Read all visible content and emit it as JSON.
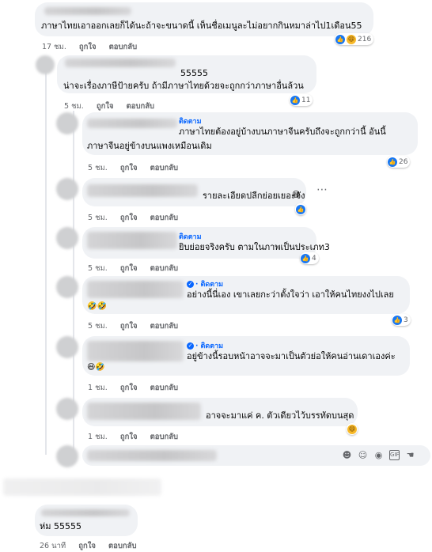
{
  "comments": [
    {
      "text_lines": [
        "ภาษาไทยเอาออกเลยก็ได้นะถ้าจะขนาดนี้ เห็นชื่อเมนูละไม่อยากกินหมาล่าไป1เดือน55"
      ],
      "reactions": "216",
      "time": "17 ชม.",
      "like": "ถูกใจ",
      "reply": "ตอบกลับ"
    },
    {
      "text_lines": [
        "55555",
        "น่าจะเรื่องภาษีป้ายครับ ถ้ามีภาษาไทยด้วยจะถูกกว่าภาษาอื่นล้วน"
      ],
      "reactions": "11",
      "time": "5 ชม.",
      "like": "ถูกใจ",
      "reply": "ตอบกลับ"
    },
    {
      "follow": "ติดตาม",
      "text_lines": [
        "ภาษาไทยต้องอยู่บ้างบนภาษาจีนครับถึงจะถูกกว่านี้ อันนี้",
        "ภาษาจีนอยู่ข้างบนแพงเหมือนเดิม"
      ],
      "reactions": "26",
      "time": "5 ชม.",
      "like": "ถูกใจ",
      "reply": "ตอบกลับ"
    },
    {
      "text_lines": [
        "รายละเอียดปลีกย่อยเยอะจัง"
      ],
      "time": "5 ชม.",
      "like": "ถูกใจ",
      "reply": "ตอบกลับ"
    },
    {
      "follow": "ติดตาม",
      "text_lines": [
        "ยิบย่อยจริงครับ ตามในภาพเป็นประเภท3"
      ],
      "reactions": "4",
      "time": "5 ชม.",
      "like": "ถูกใจ",
      "reply": "ตอบกลับ"
    },
    {
      "follow": "· ติดตาม",
      "text_lines": [
        "อย่างนี้นี่เอง เขาเลยกะว่าตั้งใจว่า เอาให้คนไทยงงไปเลย"
      ],
      "reactions": "3",
      "time": "5 ชม.",
      "like": "ถูกใจ",
      "reply": "ตอบกลับ"
    },
    {
      "follow": "· ติดตาม",
      "text_lines": [
        "อยู่ข้างนี้รอบหน้าอาจจะมาเป็นตัวย่อให้คนอ่านเดาเองค่ะ"
      ],
      "time": "1 ชม.",
      "like": "ถูกใจ",
      "reply": "ตอบกลับ"
    },
    {
      "text_lines": [
        "อาจจะมาแค่ ค. ตัวเดียวไว้บรรทัดบนสุด"
      ],
      "time": "1 ชม.",
      "like": "ถูกใจ",
      "reply": "ตอบกลับ"
    },
    {
      "text_lines": [
        "ห่ม  55555"
      ],
      "time": "26 นาที",
      "like": "ถูกใจ",
      "reply": "ตอบกลับ"
    }
  ],
  "icons": {
    "like": "like-icon",
    "haha": "haha-icon",
    "more": "more-options-icon",
    "input": [
      "sticker-icon",
      "emoji-icon",
      "camera-icon",
      "gif-icon",
      "avatar-sticker-icon"
    ]
  },
  "colors": {
    "bubble": "#f0f2f5",
    "meta": "#65676b",
    "link": "#0866ff",
    "like": "#1877f2"
  }
}
